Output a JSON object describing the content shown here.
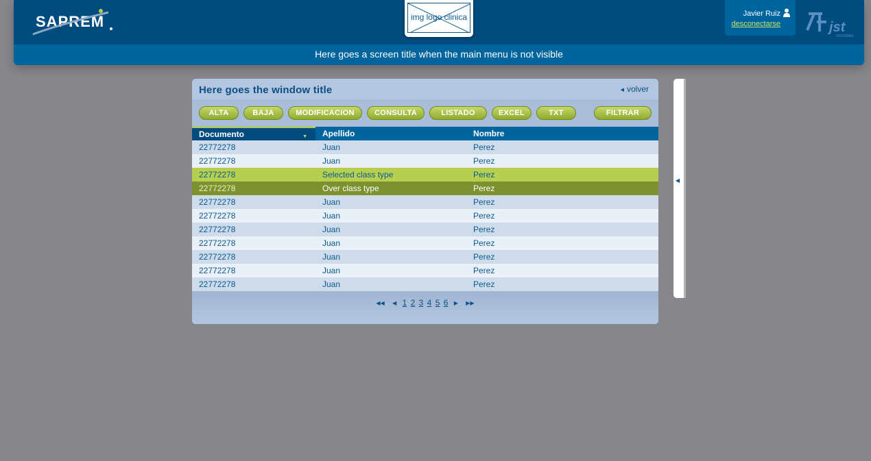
{
  "header": {
    "brand": "SAPREM",
    "clinic_logo_text": "img logo clinica",
    "screen_title": "Here goes a screen title when the main menu is not visible",
    "user_name": "Javier Ruiz",
    "logout_label": "desconectarse",
    "partner_logo_text": "jst",
    "partner_logo_sub": "SISTEMAS"
  },
  "window": {
    "title": "Here goes the window title",
    "back_label": "volver"
  },
  "toolbar": {
    "buttons": [
      "ALTA",
      "BAJA",
      "MODIFICACION",
      "CONSULTA",
      "LISTADO",
      "EXCEL",
      "TXT",
      "FILTRAR"
    ]
  },
  "table": {
    "columns": [
      "Documento",
      "Apellido",
      "Nombre"
    ],
    "rows": [
      {
        "doc": "22772278",
        "apellido": "Juan",
        "nombre": "Perez",
        "state": "odd"
      },
      {
        "doc": "22772278",
        "apellido": "Juan",
        "nombre": "Perez",
        "state": "even"
      },
      {
        "doc": "22772278",
        "apellido": "Selected class type",
        "nombre": "Perez",
        "state": "selected"
      },
      {
        "doc": "22772278",
        "apellido": "Over class type",
        "nombre": "Perez",
        "state": "over"
      },
      {
        "doc": "22772278",
        "apellido": "Juan",
        "nombre": "Perez",
        "state": "odd"
      },
      {
        "doc": "22772278",
        "apellido": "Juan",
        "nombre": "Perez",
        "state": "even"
      },
      {
        "doc": "22772278",
        "apellido": "Juan",
        "nombre": "Perez",
        "state": "odd"
      },
      {
        "doc": "22772278",
        "apellido": "Juan",
        "nombre": "Perez",
        "state": "even"
      },
      {
        "doc": "22772278",
        "apellido": "Juan",
        "nombre": "Perez",
        "state": "odd"
      },
      {
        "doc": "22772278",
        "apellido": "Juan",
        "nombre": "Perez",
        "state": "even"
      },
      {
        "doc": "22772278",
        "apellido": "Juan",
        "nombre": "Perez",
        "state": "odd"
      }
    ]
  },
  "pager": {
    "pages": [
      "1",
      "2",
      "3",
      "4",
      "5",
      "6"
    ]
  },
  "icons": {
    "user": "user-icon",
    "first": "first-page-icon",
    "prev": "prev-page-icon",
    "next": "next-page-icon",
    "last": "last-page-icon",
    "sort": "sort-desc-icon",
    "collapse": "collapse-panel-icon"
  },
  "colors": {
    "header_bg": "#004b7f",
    "header_sub_bg": "#00659e",
    "button_green": "#a7bf45",
    "row_selected": "#b7cf4f",
    "row_over": "#7b922f",
    "link_green": "#c8e06a"
  }
}
